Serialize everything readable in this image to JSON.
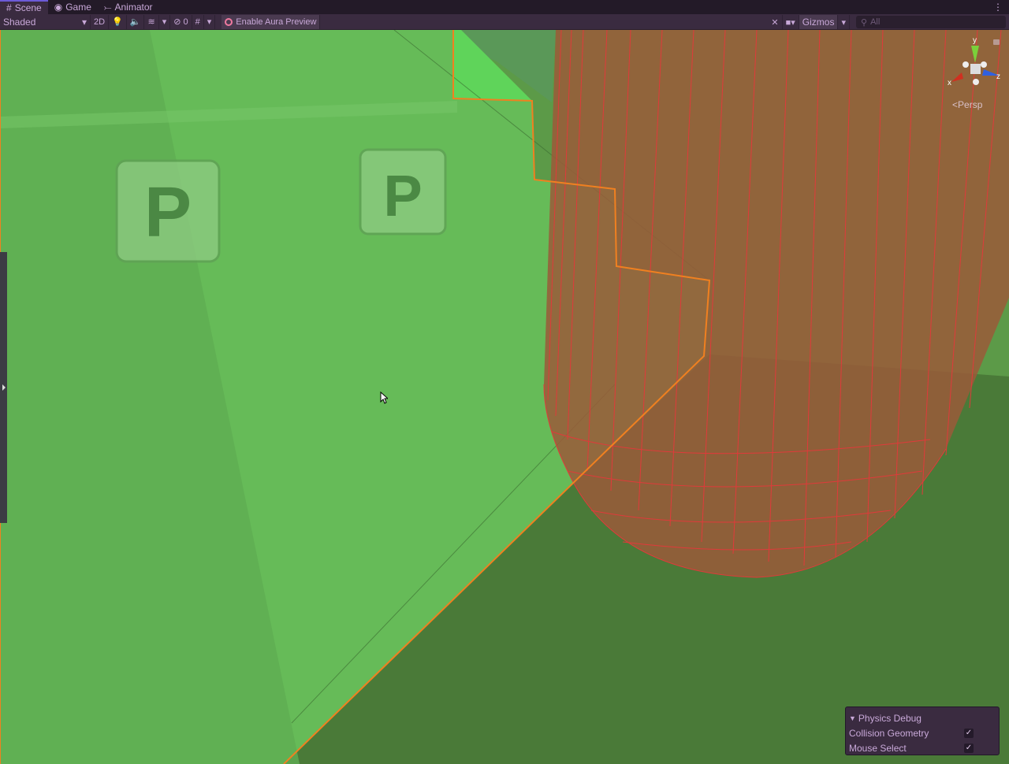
{
  "tabs": [
    {
      "label": "Scene",
      "icon": "hash-icon"
    },
    {
      "label": "Game",
      "icon": "gamepad-icon"
    },
    {
      "label": "Animator",
      "icon": "animator-icon"
    }
  ],
  "toolbar": {
    "shading": "Shaded",
    "mode_2d": "2D",
    "hidden_count": "0",
    "aura_label": "Enable Aura Preview",
    "gizmos_label": "Gizmos",
    "search_placeholder": "All"
  },
  "gizmo": {
    "y": "y",
    "x": "x",
    "z": "z",
    "projection": "Persp"
  },
  "physics_debug": {
    "title": "Physics Debug",
    "items": [
      {
        "label": "Collision Geometry",
        "checked": true
      },
      {
        "label": "Mouse Select",
        "checked": true
      }
    ]
  },
  "colors": {
    "accent": "#6c5ad8",
    "ground_light": "#66bb58",
    "ground_dark": "#4a7a38",
    "capsule": "#9a5a3a",
    "wire": "#e03a3a",
    "outline": "#f08020"
  }
}
